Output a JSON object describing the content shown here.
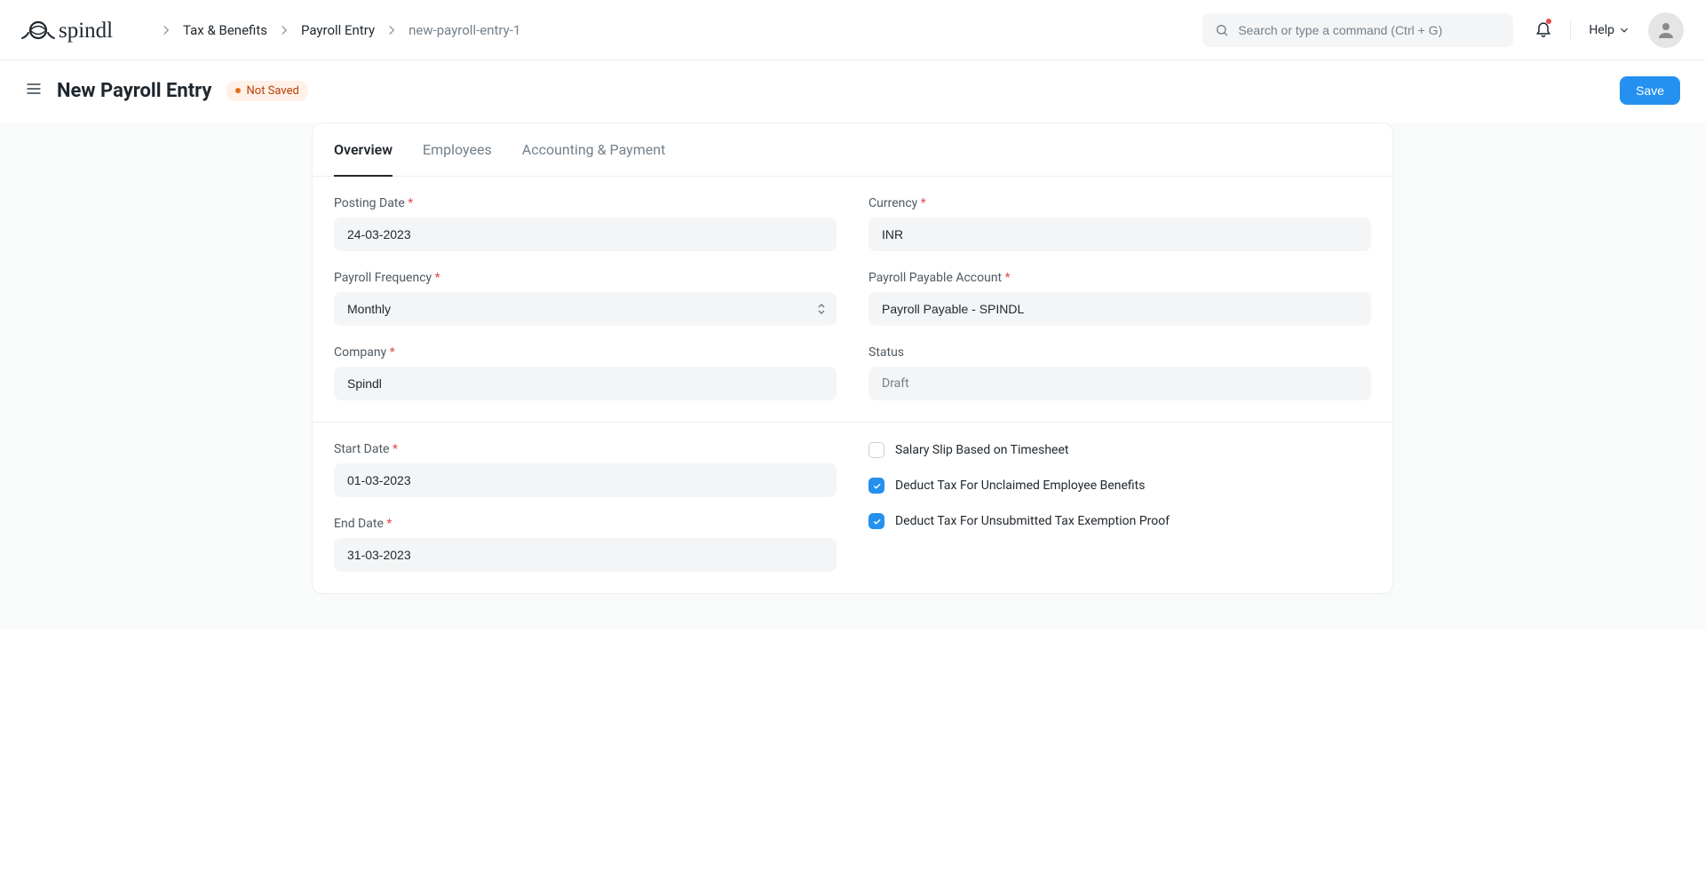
{
  "logo_text": "spindl",
  "breadcrumbs": {
    "item0": "Tax & Benefits",
    "item1": "Payroll Entry",
    "item2": "new-payroll-entry-1"
  },
  "search": {
    "placeholder": "Search or type a command (Ctrl + G)"
  },
  "help_label": "Help",
  "page": {
    "title": "New Payroll Entry",
    "status_label": "Not Saved",
    "save_label": "Save"
  },
  "tabs": {
    "t0": "Overview",
    "t1": "Employees",
    "t2": "Accounting & Payment"
  },
  "form": {
    "posting_date": {
      "label": "Posting Date",
      "value": "24-03-2023"
    },
    "currency": {
      "label": "Currency",
      "value": "INR"
    },
    "payroll_frequency": {
      "label": "Payroll Frequency",
      "value": "Monthly"
    },
    "payable_account": {
      "label": "Payroll Payable Account",
      "value": "Payroll Payable - SPINDL"
    },
    "company": {
      "label": "Company",
      "value": "Spindl"
    },
    "status": {
      "label": "Status",
      "value": "Draft"
    },
    "start_date": {
      "label": "Start Date",
      "value": "01-03-2023"
    },
    "end_date": {
      "label": "End Date",
      "value": "31-03-2023"
    },
    "cb_timesheet": "Salary Slip Based on Timesheet",
    "cb_deduct_benefits": "Deduct Tax For Unclaimed Employee Benefits",
    "cb_deduct_exemption": "Deduct Tax For Unsubmitted Tax Exemption Proof"
  }
}
